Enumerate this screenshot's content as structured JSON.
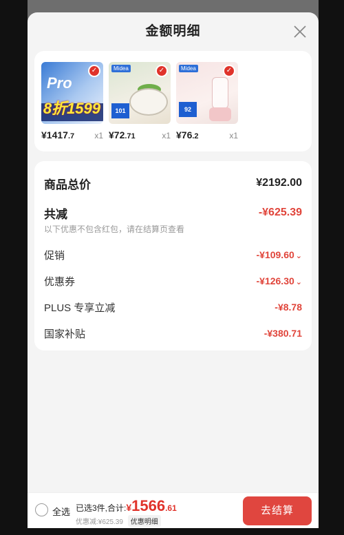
{
  "header": {
    "title": "金额明细"
  },
  "products": [
    {
      "price_int": "¥1417",
      "price_dec": ".7",
      "qty": "x1",
      "thumb_text": "Pro",
      "thumb_big": "8折1599"
    },
    {
      "price_int": "¥72",
      "price_dec": ".71",
      "qty": "x1",
      "badge": "101"
    },
    {
      "price_int": "¥76",
      "price_dec": ".2",
      "qty": "x1",
      "badge": "92"
    }
  ],
  "brand": "Midea",
  "detail": {
    "total_label": "商品总价",
    "total_value": "¥2192.00",
    "reduce_label": "共减",
    "reduce_value": "-¥625.39",
    "note": "以下优惠不包含红包，请在结算页查看",
    "items": [
      {
        "label": "促销",
        "value": "-¥109.60",
        "chevron": "⌄"
      },
      {
        "label": "优惠券",
        "value": "-¥126.30",
        "chevron": "⌄"
      },
      {
        "label": "PLUS 专享立减",
        "value": "-¥8.78",
        "chevron": ""
      },
      {
        "label": "国家补贴",
        "value": "-¥380.71",
        "chevron": ""
      }
    ]
  },
  "footer": {
    "select_all": "全选",
    "selected_text": "已选3件,合计:",
    "yen": "¥",
    "total_int": "1566",
    "total_dec": ".61",
    "discount_text": "优惠减:¥625.39",
    "detail_pill": "优惠明细",
    "checkout_label": "去结算"
  },
  "colors": {
    "accent": "#e0443a",
    "checkout": "#e0463f"
  }
}
